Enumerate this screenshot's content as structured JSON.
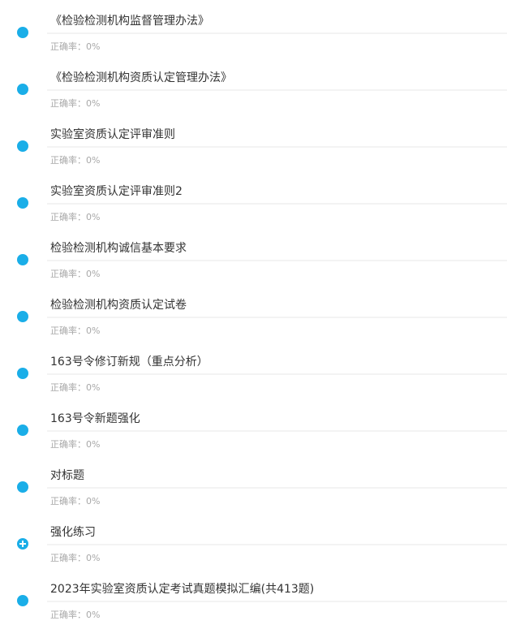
{
  "rate_prefix": "正确率：",
  "colors": {
    "accent": "#1aaee8",
    "title": "#333333",
    "subtext": "#a8a8a8",
    "divider": "#f3f3f3"
  },
  "items": [
    {
      "title": "《检验检测机构监督管理办法》",
      "rate": "0%",
      "icon": "dot-icon"
    },
    {
      "title": "《检验检测机构资质认定管理办法》",
      "rate": "0%",
      "icon": "dot-icon"
    },
    {
      "title": "实验室资质认定评审准则",
      "rate": "0%",
      "icon": "dot-icon"
    },
    {
      "title": "实验室资质认定评审准则2",
      "rate": "0%",
      "icon": "dot-icon"
    },
    {
      "title": "检验检测机构诚信基本要求",
      "rate": "0%",
      "icon": "dot-icon"
    },
    {
      "title": "检验检测机构资质认定试卷",
      "rate": "0%",
      "icon": "dot-icon"
    },
    {
      "title": "163号令修订新规（重点分析）",
      "rate": "0%",
      "icon": "dot-icon"
    },
    {
      "title": "163号令新题强化",
      "rate": "0%",
      "icon": "dot-icon"
    },
    {
      "title": "对标题",
      "rate": "0%",
      "icon": "dot-icon"
    },
    {
      "title": "强化练习",
      "rate": "0%",
      "icon": "expand-plus-icon"
    },
    {
      "title": "2023年实验室资质认定考试真题模拟汇编(共413题)",
      "rate": "0%",
      "icon": "dot-icon"
    }
  ]
}
